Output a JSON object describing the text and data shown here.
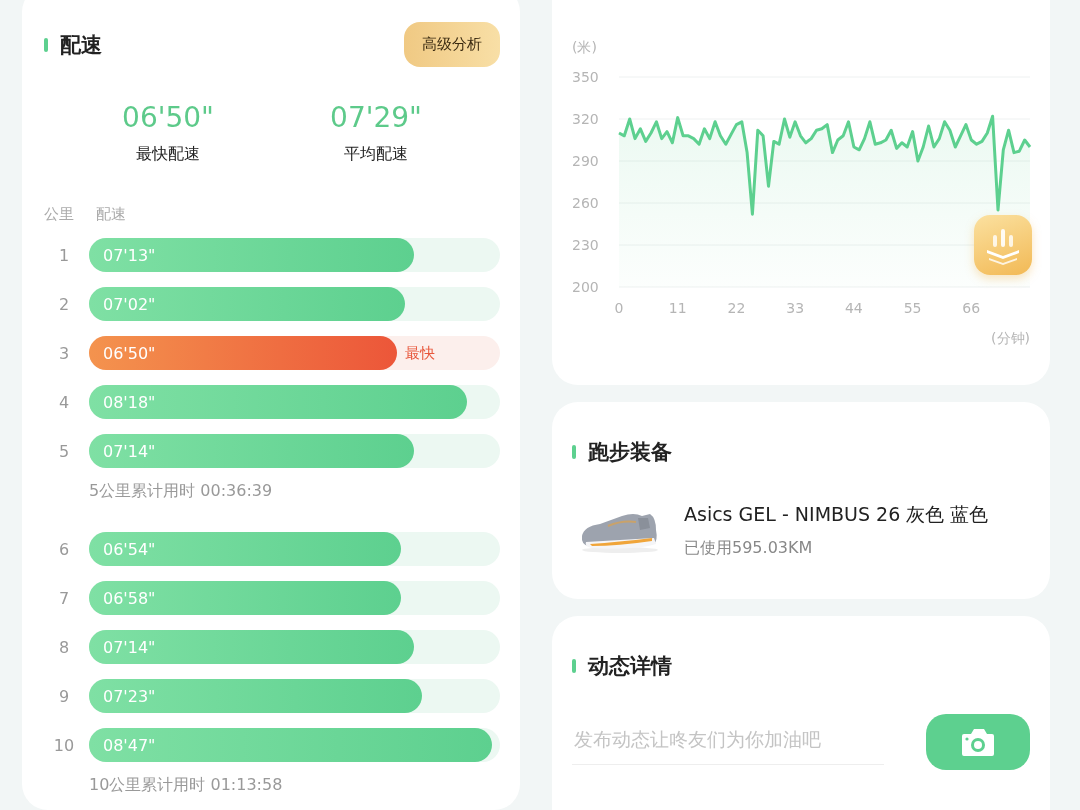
{
  "pace": {
    "title": "配速",
    "advanced_button": "高级分析",
    "stats": [
      {
        "value": "06'50\"",
        "label": "最快配速"
      },
      {
        "value": "07'29\"",
        "label": "平均配速"
      }
    ],
    "columns": [
      "公里",
      "配速"
    ],
    "groups": [
      {
        "rows": [
          {
            "km": "1",
            "pace": "07'13\"",
            "level": 0.79,
            "fastest": false
          },
          {
            "km": "2",
            "pace": "07'02\"",
            "level": 0.77,
            "fastest": false
          },
          {
            "km": "3",
            "pace": "06'50\"",
            "level": 0.75,
            "fastest": true,
            "tag": "最快"
          },
          {
            "km": "4",
            "pace": "08'18\"",
            "level": 0.92,
            "fastest": false
          },
          {
            "km": "5",
            "pace": "07'14\"",
            "level": 0.79,
            "fastest": false
          }
        ],
        "summary": "5公里累计用时 00:36:39"
      },
      {
        "rows": [
          {
            "km": "6",
            "pace": "06'54\"",
            "level": 0.76,
            "fastest": false
          },
          {
            "km": "7",
            "pace": "06'58\"",
            "level": 0.76,
            "fastest": false
          },
          {
            "km": "8",
            "pace": "07'14\"",
            "level": 0.79,
            "fastest": false
          },
          {
            "km": "9",
            "pace": "07'23\"",
            "level": 0.81,
            "fastest": false
          },
          {
            "km": "10",
            "pace": "08'47\"",
            "level": 0.98,
            "fastest": false
          }
        ],
        "summary": "10公里累计用时 01:13:58"
      }
    ]
  },
  "elevation": {
    "y_unit": "(米)",
    "x_unit": "(分钟)",
    "chart_data": {
      "type": "area",
      "grid": true,
      "ylim": [
        200,
        350
      ],
      "yticks": [
        200,
        230,
        260,
        290,
        320,
        350
      ],
      "xlim": [
        0,
        77
      ],
      "xticks": [
        0,
        11,
        22,
        33,
        44,
        55,
        66
      ],
      "x": [
        0,
        1,
        2,
        3,
        4,
        5,
        6,
        7,
        8,
        9,
        10,
        11,
        12,
        13,
        14,
        15,
        16,
        17,
        18,
        19,
        20,
        21,
        22,
        23,
        24,
        25,
        26,
        27,
        28,
        29,
        30,
        31,
        32,
        33,
        34,
        35,
        36,
        37,
        38,
        39,
        40,
        41,
        42,
        43,
        44,
        45,
        46,
        47,
        48,
        49,
        50,
        51,
        52,
        53,
        54,
        55,
        56,
        57,
        58,
        59,
        60,
        61,
        62,
        63,
        64,
        65,
        66,
        67,
        68,
        69,
        70,
        71,
        72,
        73,
        74,
        75,
        76,
        77
      ],
      "series": [
        {
          "color": "#5dd08f",
          "values": [
            310,
            308,
            320,
            306,
            313,
            304,
            310,
            318,
            306,
            311,
            303,
            321,
            308,
            308,
            306,
            302,
            313,
            306,
            318,
            308,
            302,
            309,
            316,
            318,
            296,
            252,
            312,
            308,
            272,
            304,
            302,
            320,
            307,
            318,
            308,
            303,
            306,
            312,
            313,
            316,
            296,
            305,
            308,
            318,
            300,
            298,
            306,
            318,
            302,
            303,
            305,
            312,
            299,
            303,
            300,
            311,
            290,
            300,
            315,
            300,
            306,
            318,
            312,
            300,
            308,
            316,
            305,
            302,
            304,
            310,
            322,
            255,
            298,
            312,
            296,
            297,
            305,
            300
          ]
        }
      ]
    }
  },
  "gear": {
    "title": "跑步装备",
    "shoe": {
      "kind": "picture",
      "name": "Asics GEL - NIMBUS 26 灰色 蓝色",
      "usage": "已使用595.03KM"
    }
  },
  "feed": {
    "title": "动态详情",
    "placeholder": "发布动态让咚友们为你加油吧"
  }
}
